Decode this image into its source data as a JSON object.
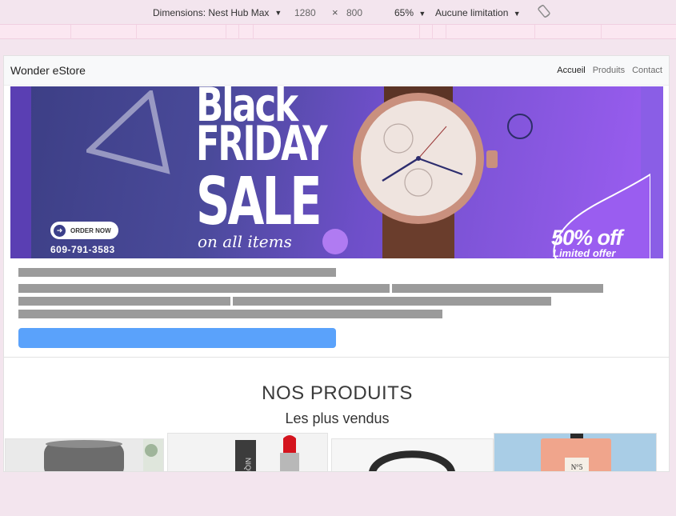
{
  "devtools": {
    "dimensions_label": "Dimensions: Nest Hub Max",
    "width": "1280",
    "times": "×",
    "height": "800",
    "zoom": "65%",
    "throttle": "Aucune limitation"
  },
  "navbar": {
    "brand": "Wonder eStore",
    "links": [
      "Accueil",
      "Produits",
      "Contact"
    ]
  },
  "hero": {
    "line1": "Black",
    "line2": "FRIDAY",
    "line3": "SALE",
    "line4": "on all items",
    "order_button": "ORDER NOW",
    "phone": "609-791-3583",
    "discount": "50% off",
    "limited": "Limited offer"
  },
  "products": {
    "heading": "NOS PRODUITS",
    "subheading": "Les plus vendus",
    "perfume_label": "N°5"
  },
  "colors": {
    "accent_button": "#5aa2fb",
    "skeleton": "#9b9b9b",
    "hero_purple": "#7b4fd8"
  }
}
